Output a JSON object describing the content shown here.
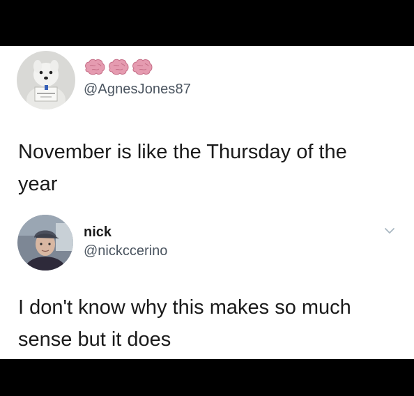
{
  "tweet1": {
    "handle": "@AgnesJones87",
    "text_lines": [
      "November is like the Thursday of the",
      "year"
    ],
    "avatar_icon": "dog-with-sign-avatar",
    "name_emojis": [
      "brain-emoji",
      "brain-emoji",
      "brain-emoji"
    ]
  },
  "tweet2": {
    "name": "nick",
    "handle": "@nickccerino",
    "text_lines": [
      "I don't know why this makes so much",
      "sense but it does"
    ],
    "avatar_icon": "person-in-cap-avatar",
    "menu_icon": "chevron-down-icon"
  },
  "colors": {
    "background": "#000000",
    "card": "#ffffff",
    "text": "#1a1a1a",
    "handle": "#4b5560",
    "brain": "#e59bb0",
    "chevron": "#aab8c2"
  }
}
